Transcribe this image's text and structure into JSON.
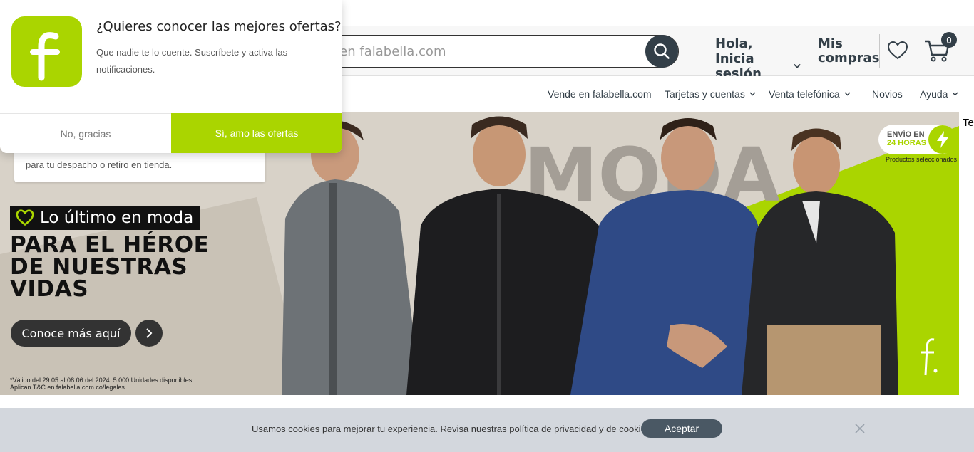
{
  "header": {
    "search_placeholder": "Buscar en falabella.com",
    "login_line1": "Hola,",
    "login_line2": "Inicia sesión",
    "purchases_line1": "Mis",
    "purchases_line2": "compras",
    "cart_count": "0"
  },
  "nav": {
    "items": [
      {
        "label": "Vende en falabella.com"
      },
      {
        "label": "Tarjetas y cuentas"
      },
      {
        "label": "Venta telefónica"
      },
      {
        "label": "Novios"
      },
      {
        "label": "Ayuda"
      }
    ]
  },
  "banner": {
    "shipping_text": "para tu despacho o retiro en tienda.",
    "tag": "Lo último en moda",
    "headline_lines": [
      "PARA EL HÉROE",
      "DE NUESTRAS",
      "VIDAS"
    ],
    "bg_word": "MODA",
    "cta": "Conoce más aquí",
    "legal_line1": "*Válido del 29.05 al 08.06 del 2024. 5.000 Unidades disponibles.",
    "legal_line2": "Aplican T&C en falabella.com.co/legales.",
    "envio_line1": "ENVÍO EN",
    "envio_line2": "24 HORAS",
    "envio_sub": "Productos seleccionados"
  },
  "side_text": "Te",
  "cookies": {
    "text_before": "Usamos cookies para mejorar tu experiencia. Revisa nuestras ",
    "privacy_link": "política de privacidad",
    "text_middle": " y de ",
    "cookies_link": "cookies",
    "text_after": ".",
    "accept": "Aceptar"
  },
  "popup": {
    "title": "¿Quieres conocer las mejores ofertas?",
    "body": "Que nadie te lo cuente. Suscríbete y activa las notificaciones.",
    "no_button": "No, gracias",
    "yes_button": "Sí, amo las ofertas"
  },
  "colors": {
    "brand_green": "#aad500",
    "dark_slate": "#333f48"
  }
}
